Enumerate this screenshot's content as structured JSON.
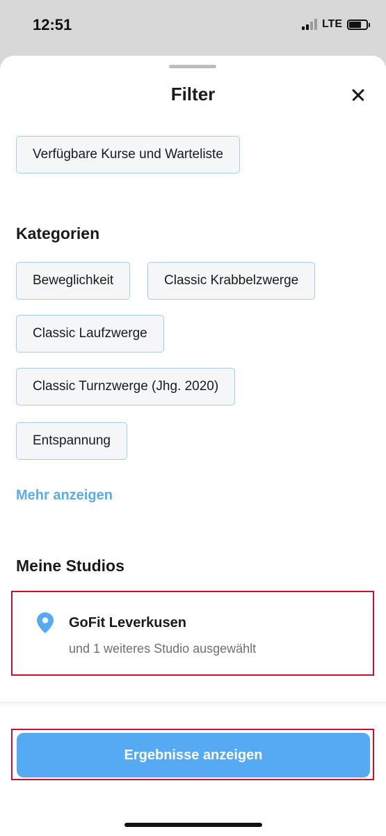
{
  "status_bar": {
    "time": "12:51",
    "network": "LTE",
    "icons": [
      "signal-icon",
      "battery-icon"
    ]
  },
  "sheet": {
    "title": "Filter",
    "close_icon": "close-icon"
  },
  "availability_filter": {
    "label": "Verfügbare Kurse und Warteliste"
  },
  "categories": {
    "title": "Kategorien",
    "items": [
      "Beweglichkeit",
      "Classic Krabbelzwerge",
      "Classic Laufzwerge",
      "Classic Turnzwerge (Jhg. 2020)",
      "Entspannung"
    ],
    "more_label": "Mehr anzeigen"
  },
  "studios": {
    "title": "Meine Studios",
    "icon": "location-pin-icon",
    "name": "GoFit Leverkusen",
    "subtitle": "und 1 weiteres Studio ausgewählt"
  },
  "actions": {
    "results_label": "Ergebnisse anzeigen"
  },
  "colors": {
    "accent": "#55aaf3",
    "chip_border": "#9ccff3",
    "highlight_border": "#c8102e"
  }
}
